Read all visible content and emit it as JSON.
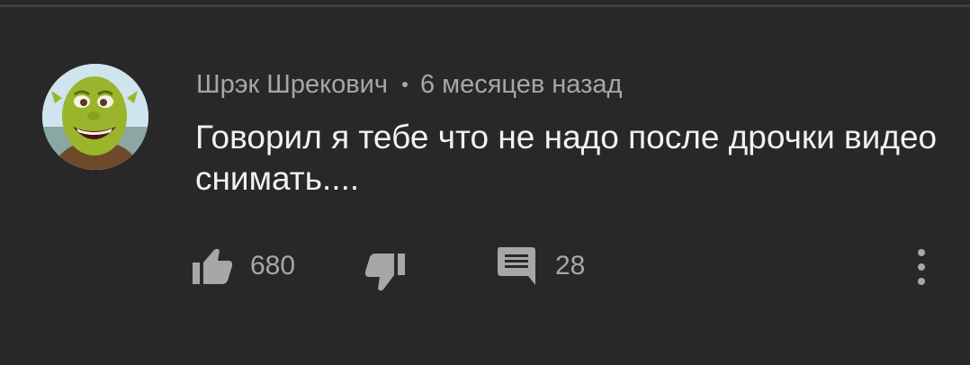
{
  "comment": {
    "author": "Шрэк Шрекович",
    "separator": "•",
    "time_ago": "6 месяцев назад",
    "text": "Говорил я тебе что не надо после дрочки видео снимать....",
    "avatar_icon": "shrek-avatar",
    "like_icon": "thumb-up-icon",
    "like_count": "680",
    "dislike_icon": "thumb-down-icon",
    "reply_icon": "comment-icon",
    "reply_count": "28",
    "more_icon": "more-vertical-icon"
  },
  "colors": {
    "background": "#282828",
    "primary_text": "#f1f1f1",
    "secondary_text": "#a7a7a7",
    "icon": "#a7a7a7",
    "avatar_face": "#9ab52b"
  }
}
